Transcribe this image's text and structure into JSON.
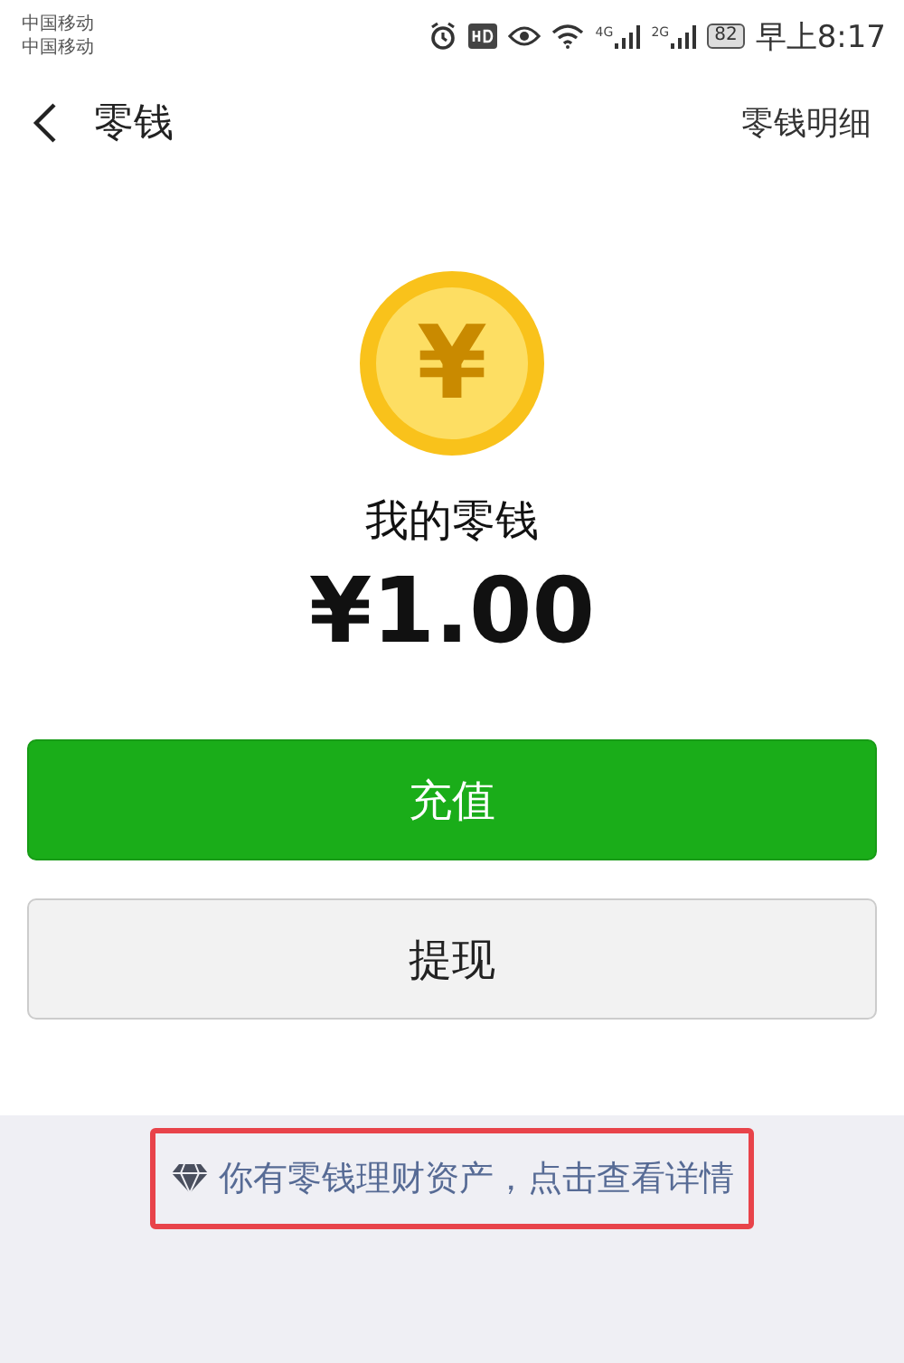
{
  "status_bar": {
    "carriers": [
      "中国移动",
      "中国移动"
    ],
    "network_labels": [
      "4G",
      "2G"
    ],
    "battery": "82",
    "time": "早上8:17"
  },
  "nav": {
    "title": "零钱",
    "action": "零钱明细"
  },
  "balance": {
    "coin_symbol": "¥",
    "label": "我的零钱",
    "amount": "¥1.00"
  },
  "buttons": [
    {
      "label": "充值",
      "kind": "primary"
    },
    {
      "label": "提现",
      "kind": "secondary"
    }
  ],
  "footer_link": {
    "text": "你有零钱理财资产，点击查看详情",
    "highlighted": true
  }
}
